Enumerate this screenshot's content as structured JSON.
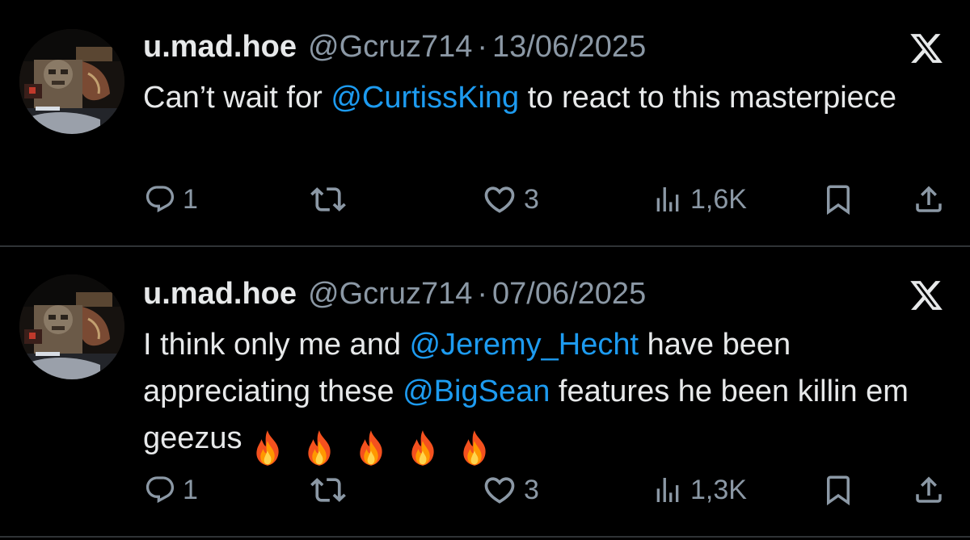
{
  "colors": {
    "background": "#000000",
    "text": "#e7e9ea",
    "secondary": "#8b98a5",
    "mention": "#1d9bf0",
    "divider": "#2f3336"
  },
  "tweets": [
    {
      "display_name": "u.mad.hoe",
      "handle": "@Gcruz714",
      "separator": "·",
      "date": "13/06/2025",
      "text_parts": [
        "Can’t wait for ",
        "@CurtissKing",
        " to react to this masterpiece"
      ],
      "replies": "1",
      "likes": "3",
      "views": "1,6K",
      "icons": [
        "reply-icon",
        "retweet-icon",
        "like-icon",
        "views-icon",
        "bookmark-icon",
        "share-icon",
        "x-logo-icon"
      ]
    },
    {
      "display_name": "u.mad.hoe",
      "handle": "@Gcruz714",
      "separator": "·",
      "date": "07/06/2025",
      "text_parts": [
        "I think only me and ",
        "@Jeremy_Hecht",
        " have been appreciating these ",
        "@BigSean",
        " features he been killin em geezus"
      ],
      "emojis": [
        "fire",
        "fire",
        "fire",
        "fire",
        "fire"
      ],
      "replies": "1",
      "likes": "3",
      "views": "1,3K",
      "icons": [
        "reply-icon",
        "retweet-icon",
        "like-icon",
        "views-icon",
        "bookmark-icon",
        "share-icon",
        "x-logo-icon"
      ]
    }
  ]
}
